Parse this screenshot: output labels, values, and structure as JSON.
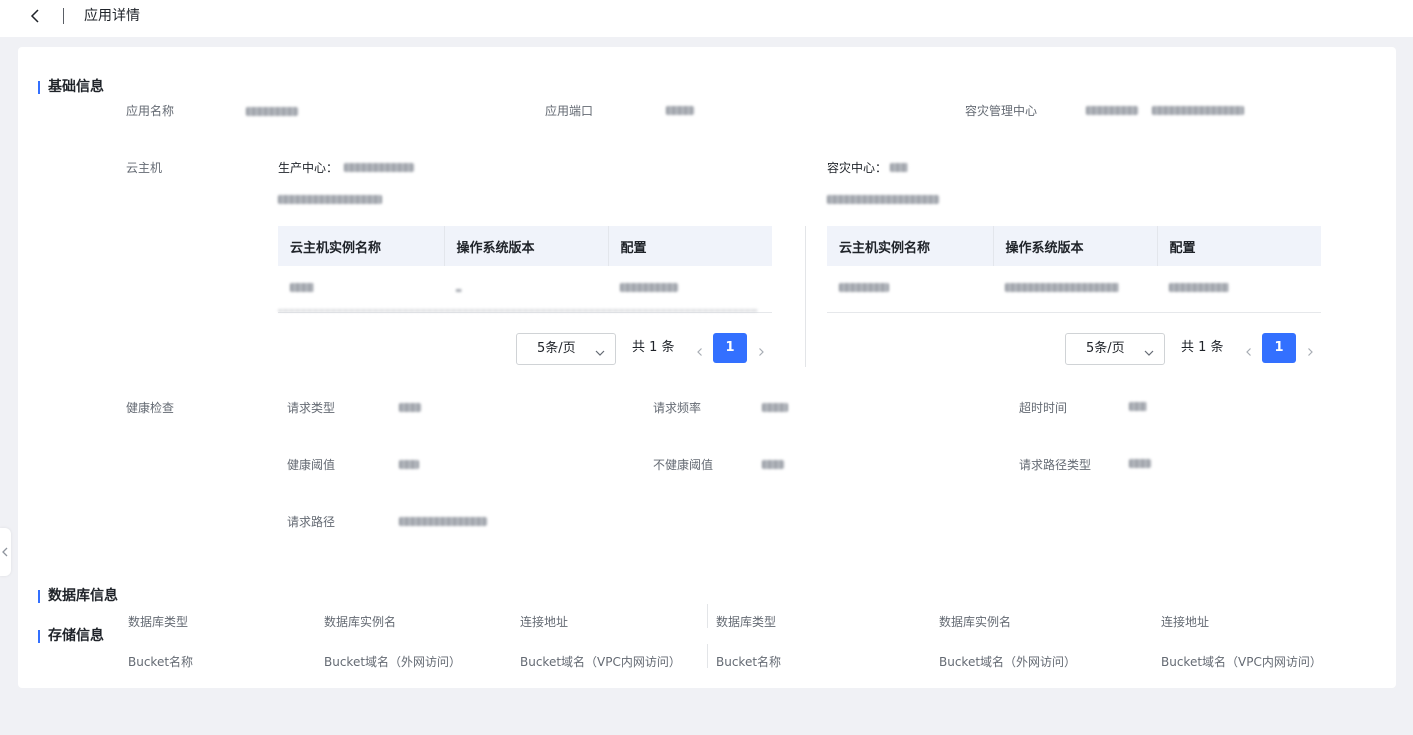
{
  "header": {
    "title": "应用详情"
  },
  "basic": {
    "title": "基础信息",
    "app_name_label": "应用名称",
    "app_port_label": "应用端口",
    "dr_center_label": "容灾管理中心"
  },
  "vm": {
    "label": "云主机",
    "prod_label": "生产中心：",
    "dr_label": "容灾中心：",
    "columns": [
      "云主机实例名称",
      "操作系统版本",
      "配置"
    ],
    "page_size": "5条/页",
    "total": "共 1 条",
    "page": "1"
  },
  "health": {
    "label": "健康检查",
    "request_type": "请求类型",
    "request_freq": "请求频率",
    "timeout": "超时时间",
    "healthy_threshold": "健康阈值",
    "unhealthy_threshold": "不健康阈值",
    "path_type": "请求路径类型",
    "path": "请求路径"
  },
  "db": {
    "title": "数据库信息",
    "type": "数据库类型",
    "instance": "数据库实例名",
    "address": "连接地址"
  },
  "storage": {
    "title": "存储信息",
    "bucket_name": "Bucket名称",
    "bucket_public": "Bucket域名（外网访问）",
    "bucket_vpc": "Bucket域名（VPC内网访问）"
  }
}
